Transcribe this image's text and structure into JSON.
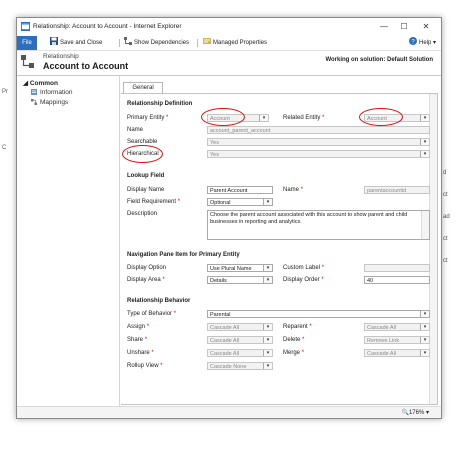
{
  "window": {
    "title": "Relationship: Account to Account - Internet Explorer",
    "minimize": "—",
    "maximize": "☐",
    "close": "✕"
  },
  "ribbon": {
    "file": "File",
    "save_close": "Save and Close",
    "show_dependencies": "Show Dependencies",
    "managed_properties": "Managed Properties",
    "help": "Help"
  },
  "header": {
    "entity_label": "Relationship",
    "title": "Account to Account",
    "solution": "Working on solution: Default Solution"
  },
  "nav": {
    "section": "Common",
    "items": [
      "Information",
      "Mappings"
    ]
  },
  "tabs": [
    "General"
  ],
  "definition": {
    "heading": "Relationship Definition",
    "primary_entity_label": "Primary Entity",
    "primary_entity_value": "Account",
    "related_entity_label": "Related Entity",
    "related_entity_value": "Account",
    "name_label": "Name",
    "name_value": "account_parent_account",
    "searchable_label": "Searchable",
    "searchable_value": "Yes",
    "hierarchical_label": "Hierarchical",
    "hierarchical_value": "Yes"
  },
  "lookup": {
    "heading": "Lookup Field",
    "display_name_label": "Display Name",
    "display_name_value": "Parent Account",
    "name_label": "Name",
    "name_value": "parentaccountid",
    "field_req_label": "Field Requirement",
    "field_req_value": "Optional",
    "description_label": "Description",
    "description_value": "Choose the parent account associated with this account to show parent and child businesses in reporting and analytics."
  },
  "navpane": {
    "heading": "Navigation Pane Item for Primary Entity",
    "display_option_label": "Display Option",
    "display_option_value": "Use Plural Name",
    "custom_label_label": "Custom Label",
    "custom_label_value": "",
    "display_area_label": "Display Area",
    "display_area_value": "Details",
    "display_order_label": "Display Order",
    "display_order_value": "40"
  },
  "behavior": {
    "heading": "Relationship Behavior",
    "type_label": "Type of Behavior",
    "type_value": "Parental",
    "assign_label": "Assign",
    "assign_value": "Cascade All",
    "reparent_label": "Reparent",
    "reparent_value": "Cascade All",
    "share_label": "Share",
    "share_value": "Cascade All",
    "delete_label": "Delete",
    "delete_value": "Remove Link",
    "unshare_label": "Unshare",
    "unshare_value": "Cascade All",
    "merge_label": "Merge",
    "merge_value": "Cascade All",
    "rollup_label": "Rollup View",
    "rollup_value": "Cascade None"
  },
  "status": {
    "zoom": "176%"
  },
  "background_text": [
    "Pr",
    "C",
    "d",
    "ct",
    "ad",
    "ct",
    "ct"
  ],
  "colors": {
    "file_button": "#2e6ebd",
    "annotation": "#dd1111",
    "required": "#cc0000"
  }
}
